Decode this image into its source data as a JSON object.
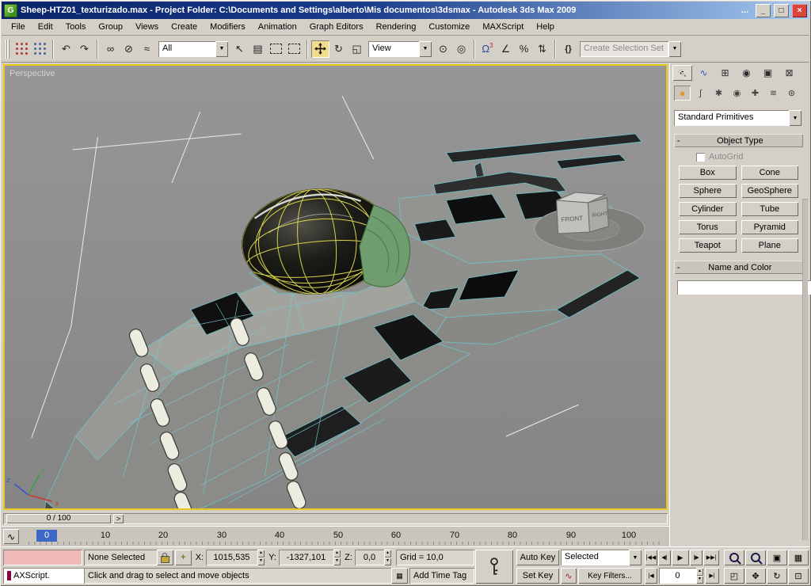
{
  "window": {
    "title": "Sheep-HTZ01_texturizado.max     - Project Folder: C:\\Documents and Settings\\alberto\\Mis documentos\\3dsmax     - Autodesk 3ds Max  2009",
    "overflow": "..."
  },
  "menu": {
    "items": [
      "File",
      "Edit",
      "Tools",
      "Group",
      "Views",
      "Create",
      "Modifiers",
      "Animation",
      "Graph Editors",
      "Rendering",
      "Customize",
      "MAXScript",
      "Help"
    ]
  },
  "toolbar": {
    "selection_filter": "All",
    "ref_coord": "View",
    "selection_set": "Create Selection Set"
  },
  "icons": {
    "minimize": "_",
    "maximize": "□",
    "close": "×",
    "undo": "↶",
    "redo": "↷",
    "link": "∞",
    "unlink": "⊘",
    "bind": "≈",
    "select_arrow": "↖",
    "by_name": "▤",
    "rotate": "↻",
    "scale": "◱",
    "pivot_center": "⊙",
    "manipulate": "◎",
    "snap_magnet": "Ω",
    "snap_sup": "3",
    "angle_snap": "∠",
    "percent_snap": "%",
    "spinner_snap": "⇅",
    "named_sets": "{}",
    "arrow_down": "▼",
    "arrow_right": ">",
    "minus": "-",
    "tab_create": "↖",
    "tab_modify": "∿",
    "tab_hierarchy": "⊞",
    "tab_motion": "◉",
    "tab_display": "▣",
    "tab_utilities": "⊠",
    "cat_geometry": "●",
    "cat_shapes": "∫",
    "cat_lights": "✱",
    "cat_cameras": "◉",
    "cat_helpers": "✚",
    "cat_space_warps": "≋",
    "cat_systems": "⊛",
    "go_start": "|◀◀",
    "prev_frame": "◀|",
    "play": "▶",
    "next_frame": "|▶",
    "go_end": "▶▶|",
    "prev_key": "|◀",
    "next_key": "▶|",
    "zoom_extents": "▣",
    "zoom_extents_all": "▦",
    "zoom_region": "◰",
    "pan": "✥",
    "arc_rotate": "↻",
    "min_max": "⊡",
    "curve": "∿",
    "keyboard": "▦",
    "abs_offset": "+",
    "tangent": "∿",
    "spin_up": "▲",
    "spin_down": "▼"
  },
  "viewport": {
    "label": "Perspective",
    "helper_front": "FRONT",
    "helper_right": "RIGHT",
    "axis": {
      "x": "x",
      "y": "y",
      "z": "z"
    }
  },
  "command_panel": {
    "category_dropdown": "Standard Primitives",
    "object_type": {
      "title": "Object Type",
      "autogrid": "AutoGrid"
    },
    "object_buttons": [
      "Box",
      "Cone",
      "Sphere",
      "GeoSphere",
      "Cylinder",
      "Tube",
      "Torus",
      "Pyramid",
      "Teapot",
      "Plane"
    ],
    "name_color": {
      "title": "Name and Color"
    },
    "name_value": ""
  },
  "timeline": {
    "slider": "0 / 100",
    "ticks": [
      "0",
      "10",
      "20",
      "30",
      "40",
      "50",
      "60",
      "70",
      "80",
      "90",
      "100"
    ]
  },
  "status": {
    "listener": "AXScript.",
    "selection": "None Selected",
    "x_label": "X:",
    "x_value": "1015,535",
    "y_label": "Y:",
    "y_value": "-1327,101",
    "z_label": "Z:",
    "z_value": "0,0",
    "grid": "Grid = 10,0",
    "prompt": "Click and drag to select and move objects",
    "add_time_tag": "Add Time Tag",
    "auto_key": "Auto Key",
    "set_key": "Set Key",
    "key_mode": "Selected",
    "key_filters": "Key Filters...",
    "frame": "0"
  },
  "colors": {
    "viewport_border": "#e9c81c",
    "wireframe": "#73cbd4",
    "dome_wire": "#d8d44a",
    "name_color_swatch": "#8d0045",
    "titlebar": "#0a246a"
  }
}
